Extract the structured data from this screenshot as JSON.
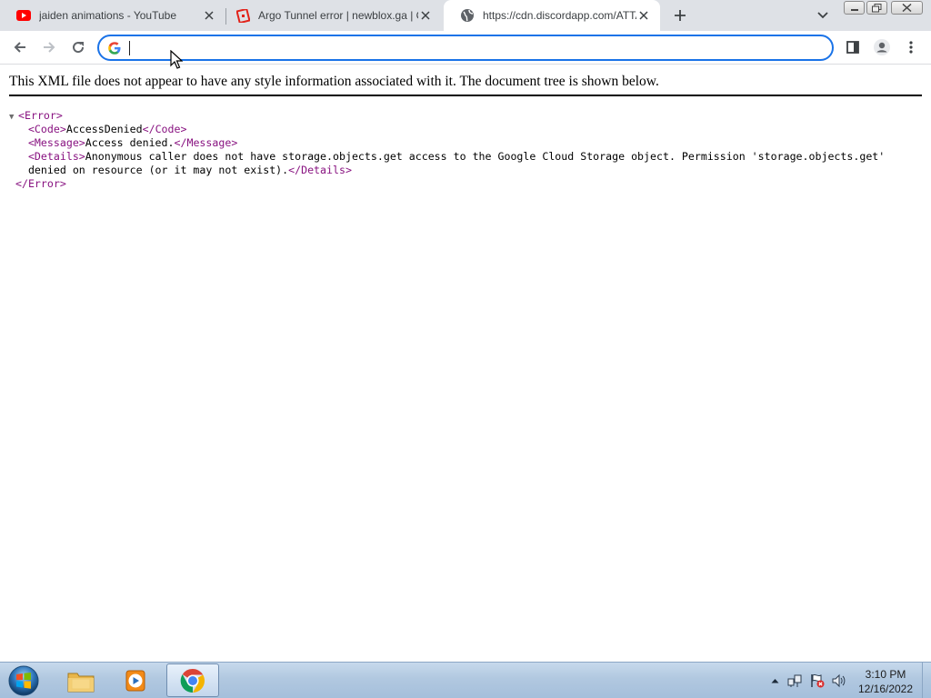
{
  "tabs": [
    {
      "title": "jaiden animations - YouTube",
      "icon": "youtube-icon"
    },
    {
      "title": "Argo Tunnel error | newblox.ga | Cloudflare",
      "icon": "roblox-icon"
    },
    {
      "title": "https://cdn.discordapp.com/ATTACHMENTS",
      "icon": "globe-icon",
      "active": true
    }
  ],
  "omnibox": {
    "value": "",
    "icon": "google-icon"
  },
  "xml": {
    "notice": "This XML file does not appear to have any style information associated with it. The document tree is shown below.",
    "root_open": "<Error>",
    "code_open": "<Code>",
    "code_value": "AccessDenied",
    "code_close": "</Code>",
    "message_open": "<Message>",
    "message_value": "Access denied.",
    "message_close": "</Message>",
    "details_open": "<Details>",
    "details_value_line1": "Anonymous caller does not have storage.objects.get access to the Google Cloud Storage object. Permission 'storage.objects.get'",
    "details_value_line2": "denied on resource (or it may not exist).",
    "details_close": "</Details>",
    "root_close": "</Error>"
  },
  "taskbar": {
    "clock_time": "3:10 PM",
    "clock_date": "12/16/2022",
    "pinned": [
      "explorer-icon",
      "media-player-icon",
      "chrome-icon"
    ]
  },
  "colors": {
    "accent": "#1a73e8",
    "tabstrip": "#dee1e6",
    "xml_tag": "#881280",
    "youtube_red": "#ff0000"
  }
}
